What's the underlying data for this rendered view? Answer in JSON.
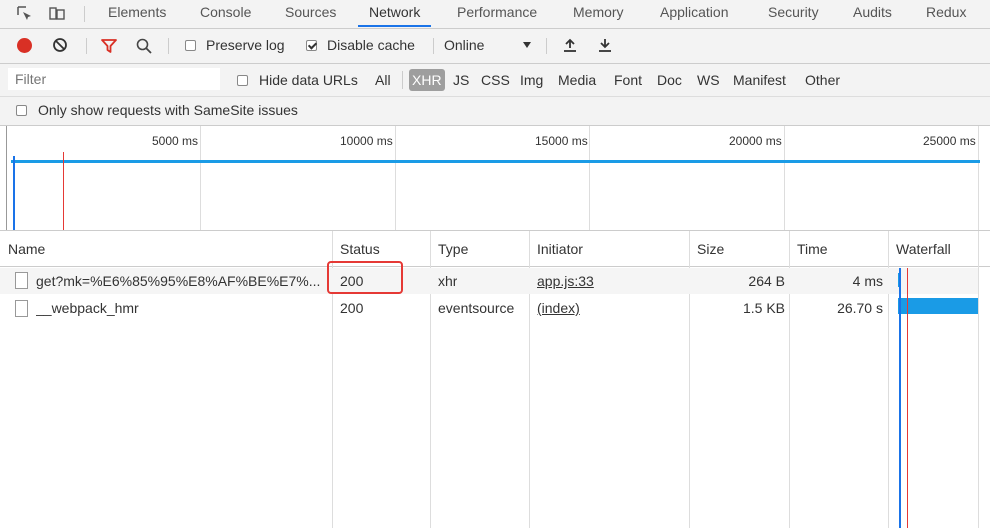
{
  "tabs": [
    {
      "label": "Elements"
    },
    {
      "label": "Console"
    },
    {
      "label": "Sources"
    },
    {
      "label": "Network"
    },
    {
      "label": "Performance"
    },
    {
      "label": "Memory"
    },
    {
      "label": "Application"
    },
    {
      "label": "Security"
    },
    {
      "label": "Audits"
    },
    {
      "label": "Redux"
    }
  ],
  "active_tab": "Network",
  "toolbar": {
    "preserve_log": "Preserve log",
    "disable_cache": "Disable cache",
    "throttle": "Online",
    "preserve_log_checked": false,
    "disable_cache_checked": true
  },
  "filter": {
    "placeholder": "Filter",
    "hide_data_urls": "Hide data URLs",
    "types": [
      "All",
      "XHR",
      "JS",
      "CSS",
      "Img",
      "Media",
      "Font",
      "Doc",
      "WS",
      "Manifest",
      "Other"
    ],
    "selected_type": "XHR"
  },
  "samesite": "Only show requests with SameSite issues",
  "timeline": {
    "ticks": [
      "5000 ms",
      "10000 ms",
      "15000 ms",
      "20000 ms",
      "25000 ms"
    ]
  },
  "table": {
    "headers": [
      "Name",
      "Status",
      "Type",
      "Initiator",
      "Size",
      "Time",
      "Waterfall"
    ],
    "rows": [
      {
        "name": "get?mk=%E6%85%95%E8%AF%BE%E7%...",
        "status": "200",
        "type": "xhr",
        "initiator": "app.js:33",
        "size": "264 B",
        "time": "4 ms"
      },
      {
        "name": "__webpack_hmr",
        "status": "200",
        "type": "eventsource",
        "initiator": "(index)",
        "size": "1.5 KB",
        "time": "26.70 s"
      }
    ]
  },
  "colors": {
    "accent": "#1a73e8",
    "record": "#d93025",
    "highlight_box": "#e53935",
    "xhr_bg": "#9e9e9e",
    "waterfall": "#1a9be6"
  }
}
